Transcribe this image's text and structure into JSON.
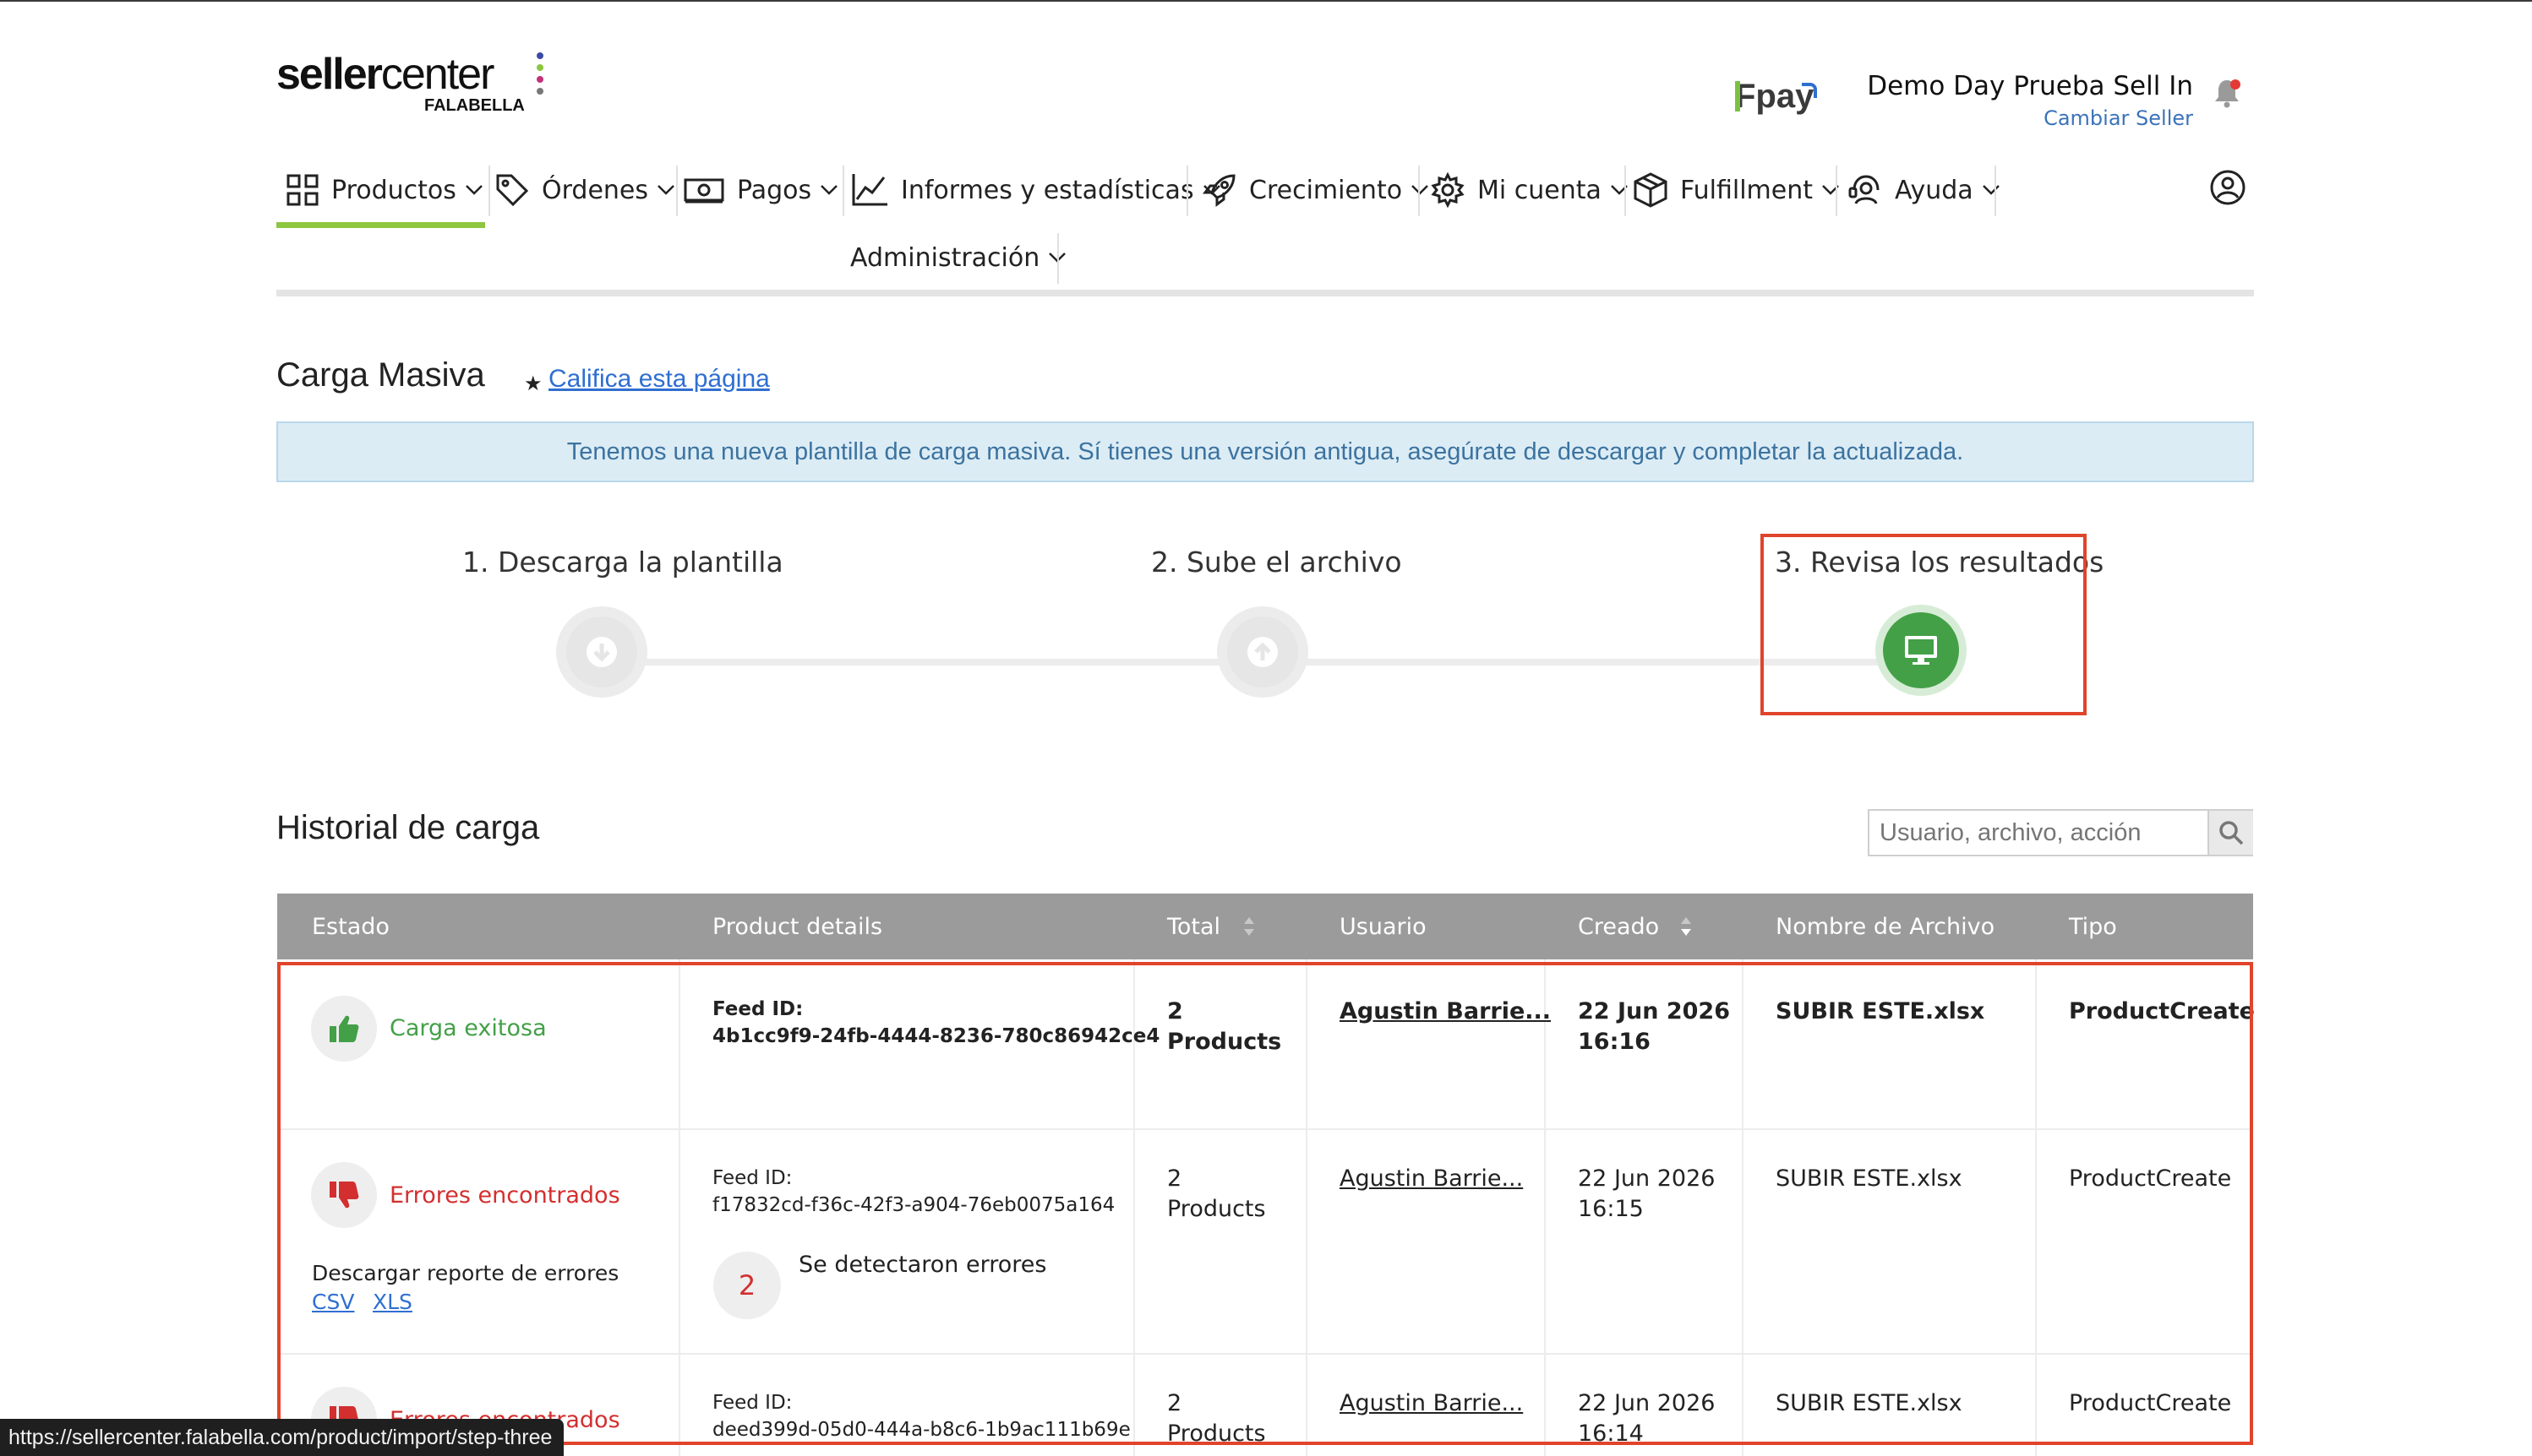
{
  "header": {
    "logo_seller": "seller",
    "logo_center": "center",
    "logo_falabella": "FALABELLA",
    "fpay": "Fpay",
    "account_name": "Demo Day Prueba Sell In",
    "switch_seller": "Cambiar Seller"
  },
  "nav": {
    "items": [
      {
        "label": "Productos"
      },
      {
        "label": "Órdenes"
      },
      {
        "label": "Pagos"
      },
      {
        "label": "Informes y estadísticas"
      },
      {
        "label": "Crecimiento"
      },
      {
        "label": "Mi cuenta"
      },
      {
        "label": "Fulfillment"
      },
      {
        "label": "Ayuda"
      },
      {
        "label": "Administración"
      }
    ],
    "active": "Productos"
  },
  "page": {
    "title": "Carga Masiva",
    "rate_link": "Califica esta página",
    "info_banner": "Tenemos una nueva plantilla de carga masiva. Sí tienes una versión antigua, asegúrate de descargar y completar la actualizada."
  },
  "steps": [
    {
      "label": "1. Descarga la plantilla",
      "icon": "arrow-down-icon",
      "active": false
    },
    {
      "label": "2. Sube el archivo",
      "icon": "arrow-up-icon",
      "active": false
    },
    {
      "label": "3. Revisa los resultados",
      "icon": "monitor-icon",
      "active": true
    }
  ],
  "history": {
    "title": "Historial de carga",
    "search_placeholder": "Usuario, archivo, acción",
    "columns": [
      "Estado",
      "Product details",
      "Total",
      "Usuario",
      "Creado",
      "Nombre de Archivo",
      "Tipo"
    ],
    "rows": [
      {
        "status": "Carga exitosa",
        "feed_label": "Feed ID:",
        "feed_id": "4b1cc9f9-24fb-4444-8236-780c86942ce4",
        "total_num": "2",
        "total_unit": "Products",
        "user": "Agustin Barrie...",
        "date": "22 Jun 2026",
        "time": "16:16",
        "file": "SUBIR ESTE.xlsx",
        "type": "ProductCreate"
      },
      {
        "status": "Errores encontrados",
        "feed_label": "Feed ID:",
        "feed_id": "f17832cd-f36c-42f3-a904-76eb0075a164",
        "total_num": "2",
        "total_unit": "Products",
        "user": "Agustin Barrie...",
        "date": "22 Jun 2026",
        "time": "16:15",
        "file": "SUBIR ESTE.xlsx",
        "type": "ProductCreate",
        "report_label": "Descargar reporte de errores",
        "csv": "CSV",
        "xls": "XLS",
        "error_count": "2",
        "error_text": "Se detectaron errores"
      },
      {
        "status": "Errores encontrados",
        "feed_label": "Feed ID:",
        "feed_id": "deed399d-05d0-444a-b8c6-1b9ac111b69e",
        "total_num": "2",
        "total_unit": "Products",
        "user": "Agustin Barrie...",
        "date": "22 Jun 2026",
        "time": "16:14",
        "file": "SUBIR ESTE.xlsx",
        "type": "ProductCreate"
      }
    ]
  },
  "statusbar": {
    "url": "https://sellercenter.falabella.com/product/import/step-three"
  },
  "colors": {
    "accent_green": "#8dc63f",
    "success": "#43a047",
    "error": "#d32f2f",
    "table_header": "#9b9b9b",
    "banner_bg": "#dcecf5",
    "annotation": "#e0442b"
  }
}
